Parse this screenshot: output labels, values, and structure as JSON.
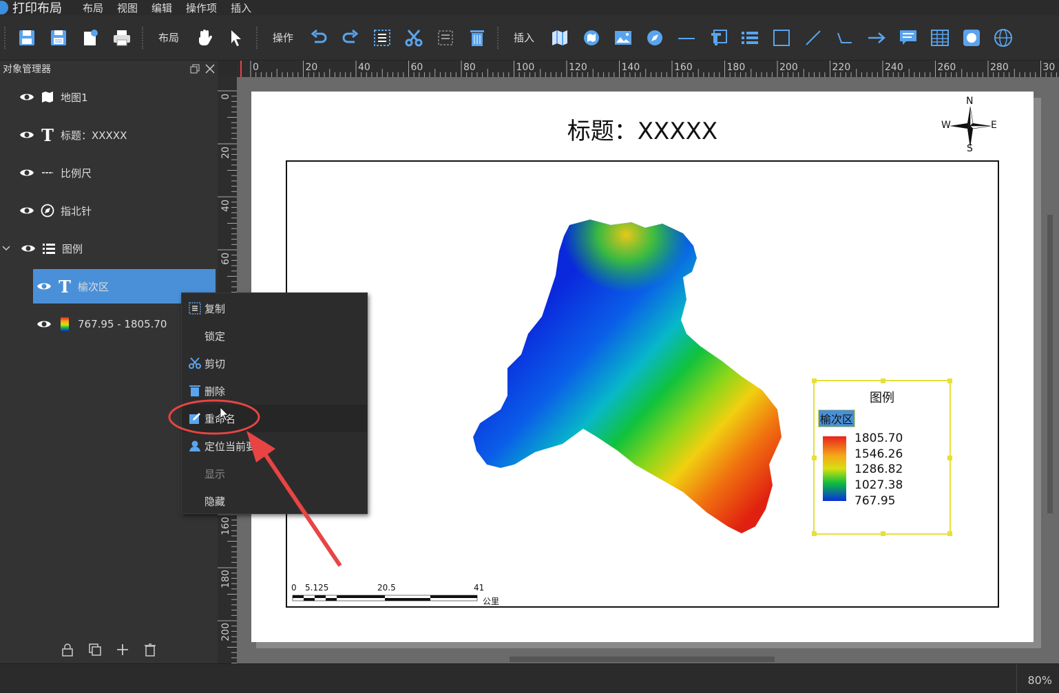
{
  "app": {
    "title": "打印布局"
  },
  "menu": [
    "布局",
    "视图",
    "编辑",
    "操作项",
    "插入"
  ],
  "toolbar": {
    "group_layout": "布局",
    "group_operate": "操作",
    "group_insert": "插入",
    "icons": [
      "save-icon",
      "save-as-icon",
      "page-settings-icon",
      "print-icon",
      "pan-hand-icon",
      "select-arrow-icon",
      "undo-icon",
      "redo-icon",
      "copy-icon",
      "cut-icon",
      "paste-icon",
      "delete-icon",
      "insert-map-icon",
      "insert-overview-icon",
      "insert-image-icon",
      "insert-north-arrow-icon",
      "insert-scale-bar-icon",
      "insert-text-icon",
      "insert-legend-icon",
      "insert-rectangle-icon",
      "insert-line-icon",
      "insert-polyline-icon",
      "insert-arrow-icon",
      "insert-callout-icon",
      "insert-table-icon",
      "insert-shape-icon",
      "insert-globe-icon"
    ]
  },
  "object_panel": {
    "title": "对象管理器",
    "items": [
      {
        "label": "地图1",
        "icon": "map-icon"
      },
      {
        "label": "标题：XXXXX",
        "icon": "text-icon"
      },
      {
        "label": "比例尺",
        "icon": "scale-bar-icon"
      },
      {
        "label": "指北针",
        "icon": "compass-icon"
      },
      {
        "label": "图例",
        "icon": "legend-icon"
      },
      {
        "label": "榆次区",
        "icon": "text-icon",
        "selected": true
      },
      {
        "label": "767.95 - 1805.70",
        "icon": "color-ramp-icon"
      }
    ]
  },
  "ruler": {
    "top_ticks": [
      "0",
      "20",
      "40",
      "60",
      "80",
      "100",
      "120",
      "140",
      "160",
      "180",
      "200",
      "220",
      "240",
      "260",
      "280",
      "30"
    ],
    "left_ticks": [
      "0",
      "20",
      "40",
      "60",
      "160",
      "180",
      "200"
    ]
  },
  "page": {
    "title": "标题：XXXXX",
    "north_arrow": {
      "n": "N",
      "s": "S",
      "e": "E",
      "w": "W"
    },
    "legend": {
      "title": "图例",
      "layer": "榆次区",
      "values": [
        "1805.70",
        "1546.26",
        "1286.82",
        "1027.38",
        "767.95"
      ]
    },
    "scale_bar": {
      "labels": [
        "0",
        "5.125",
        "20.5",
        "41"
      ],
      "unit": "公里"
    }
  },
  "context_menu": {
    "items": [
      {
        "label": "复制",
        "icon": "copy-icon"
      },
      {
        "label": "锁定",
        "icon": ""
      },
      {
        "label": "剪切",
        "icon": "cut-icon"
      },
      {
        "label": "删除",
        "icon": "delete-icon"
      },
      {
        "label": "重命名",
        "icon": "rename-icon",
        "hovered": true
      },
      {
        "label": "定位当前要素",
        "icon": "locate-icon"
      },
      {
        "label": "显示",
        "icon": "",
        "disabled": true
      },
      {
        "label": "隐藏",
        "icon": ""
      }
    ]
  },
  "status": {
    "zoom": "80%"
  },
  "colors": {
    "accent": "#3b8fe0",
    "selection": "#4a90d9",
    "annotation": "#e84444",
    "legend_frame": "#e6e03a"
  }
}
